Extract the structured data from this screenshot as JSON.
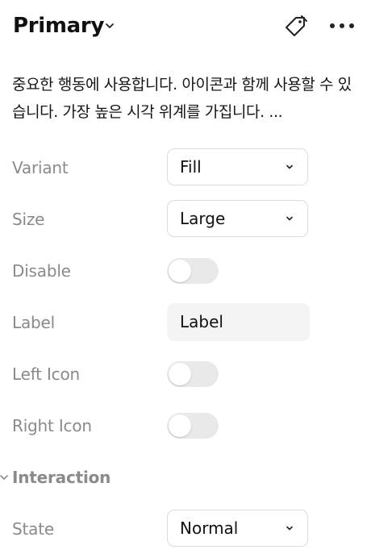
{
  "header": {
    "title": "Primary",
    "title_icon": "chevron-down-icon",
    "tag_icon": "tag-link-icon",
    "more_icon": "more-horizontal-icon"
  },
  "description": "중요한 행동에 사용합니다. 아이콘과 함께 사용할 수 있습니다. 가장 높은 시각 위계를 가집니다. ...",
  "properties": {
    "variant": {
      "label": "Variant",
      "value": "Fill"
    },
    "size": {
      "label": "Size",
      "value": "Large"
    },
    "disable": {
      "label": "Disable",
      "checked": false
    },
    "label_field": {
      "label": "Label",
      "value": "Label"
    },
    "left_icon": {
      "label": "Left Icon",
      "checked": false
    },
    "right_icon": {
      "label": "Right Icon",
      "checked": false
    }
  },
  "interaction": {
    "section_label": "Interaction",
    "state": {
      "label": "State",
      "value": "Normal"
    }
  },
  "colors": {
    "text_primary": "#111111",
    "text_muted": "#8a8a8a",
    "border": "#dcdcdc",
    "toggle_off": "#e9e9e9",
    "input_bg": "#f4f4f4"
  }
}
